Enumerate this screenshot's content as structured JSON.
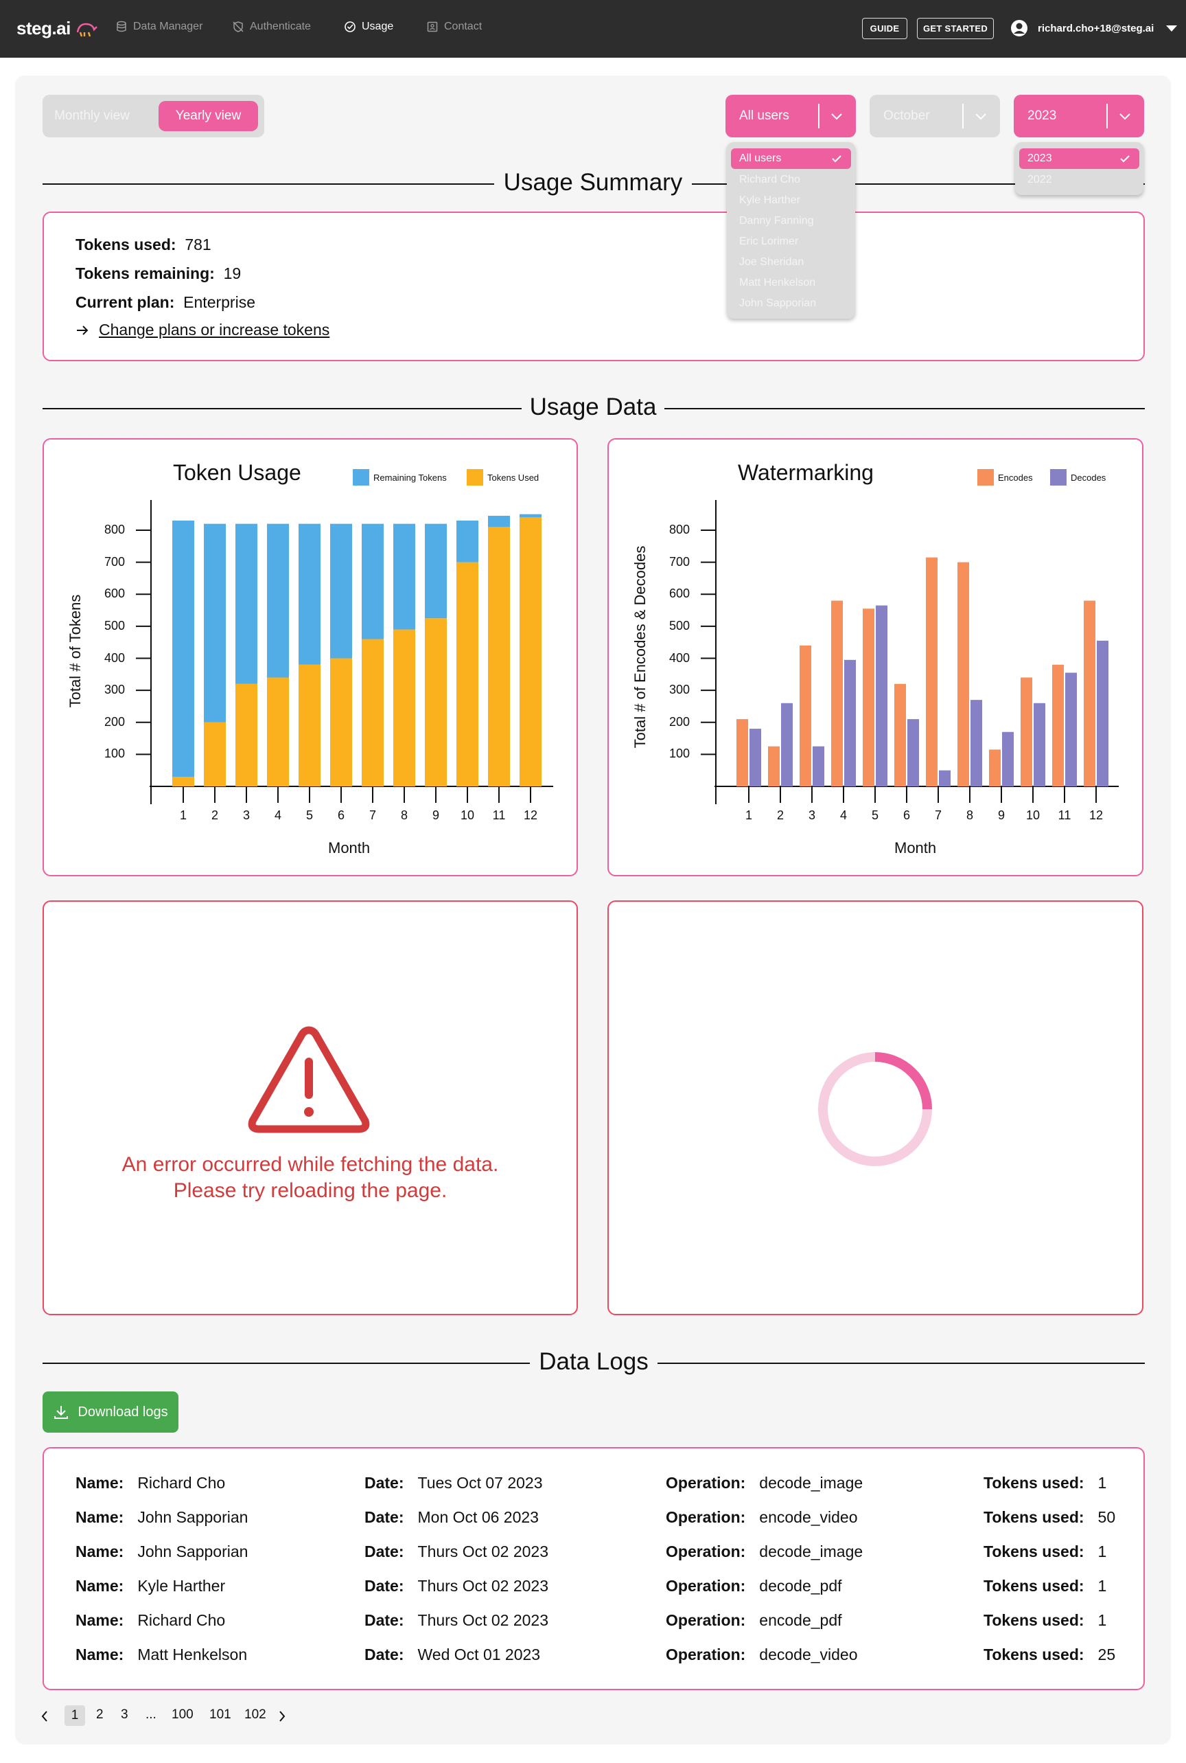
{
  "nav": {
    "logo": "steg.ai",
    "items": [
      {
        "label": "Data Manager",
        "icon": "database-icon"
      },
      {
        "label": "Authenticate",
        "icon": "shield-off-icon"
      },
      {
        "label": "Usage",
        "icon": "check-circle-icon"
      },
      {
        "label": "Contact",
        "icon": "contact-card-icon"
      }
    ],
    "guide_label": "GUIDE",
    "get_started_label": "GET STARTED",
    "user_email": "richard.cho+18@steg.ai"
  },
  "view_toggle": {
    "monthly": "Monthly view",
    "yearly": "Yearly view",
    "selected": "Yearly view"
  },
  "filters": {
    "users": {
      "selected": "All users",
      "options": [
        "All users",
        "Richard Cho",
        "Kyle Harther",
        "Danny Fanning",
        "Eric Lorimer",
        "Joe Sheridan",
        "Matt Henkelson",
        "John Sapporian"
      ]
    },
    "month": {
      "selected": "October"
    },
    "year": {
      "selected": "2023",
      "options": [
        "2023",
        "2022"
      ]
    }
  },
  "colors": {
    "accent": "#ee5fa0",
    "remaining": "#52ace5",
    "used": "#fbb11e",
    "encodes": "#f78f5b",
    "decodes": "#8680c4",
    "error": "#d23b3b",
    "success": "#47a84d"
  },
  "summary": {
    "title": "Usage Summary",
    "tokens_used_label": "Tokens used:",
    "tokens_used": "781",
    "tokens_remaining_label": "Tokens remaining:",
    "tokens_remaining": "19",
    "plan_label": "Current plan:",
    "plan": "Enterprise",
    "change_link": "Change plans or increase tokens"
  },
  "usage_data": {
    "title": "Usage Data"
  },
  "chart_data": [
    {
      "type": "bar",
      "title": "Token Usage",
      "xlabel": "Month",
      "ylabel": "Total # of Tokens",
      "categories": [
        "1",
        "2",
        "3",
        "4",
        "5",
        "6",
        "7",
        "8",
        "9",
        "10",
        "11",
        "12"
      ],
      "series": [
        {
          "name": "Remaining Tokens",
          "values": [
            800,
            620,
            500,
            480,
            440,
            420,
            360,
            330,
            295,
            130,
            35,
            10
          ]
        },
        {
          "name": "Tokens Used",
          "values": [
            30,
            200,
            320,
            340,
            380,
            400,
            460,
            490,
            525,
            700,
            810,
            840
          ]
        }
      ],
      "stacked": true,
      "yticks": [
        100,
        200,
        300,
        400,
        500,
        600,
        700,
        800
      ],
      "ylim": [
        0,
        850
      ],
      "legend": "top-right"
    },
    {
      "type": "bar",
      "title": "Watermarking",
      "xlabel": "Month",
      "ylabel": "Total # of Encodes & Decodes",
      "categories": [
        "1",
        "2",
        "3",
        "4",
        "5",
        "6",
        "7",
        "8",
        "9",
        "10",
        "11",
        "12"
      ],
      "series": [
        {
          "name": "Encodes",
          "values": [
            210,
            125,
            440,
            580,
            555,
            320,
            715,
            700,
            115,
            340,
            380,
            580
          ]
        },
        {
          "name": "Decodes",
          "values": [
            180,
            260,
            125,
            395,
            565,
            210,
            50,
            270,
            170,
            260,
            355,
            455
          ]
        }
      ],
      "yticks": [
        100,
        200,
        300,
        400,
        500,
        600,
        700,
        800
      ],
      "ylim": [
        0,
        850
      ],
      "legend": "top-right"
    }
  ],
  "error_card": {
    "line1": "An error occurred while fetching the data.",
    "line2": "Please try reloading the page."
  },
  "logs": {
    "title": "Data Logs",
    "download_label": "Download logs",
    "keys": {
      "name": "Name:",
      "date": "Date:",
      "operation": "Operation:",
      "tokens": "Tokens used:"
    },
    "rows": [
      {
        "name": "Richard Cho",
        "date": "Tues Oct 07 2023",
        "operation": "decode_image",
        "tokens": "1"
      },
      {
        "name": "John Sapporian",
        "date": "Mon Oct 06 2023",
        "operation": "encode_video",
        "tokens": "50"
      },
      {
        "name": "John Sapporian",
        "date": "Thurs Oct 02 2023",
        "operation": "decode_image",
        "tokens": "1"
      },
      {
        "name": "Kyle Harther",
        "date": "Thurs Oct 02 2023",
        "operation": "decode_pdf",
        "tokens": "1"
      },
      {
        "name": "Richard Cho",
        "date": "Thurs Oct 02 2023",
        "operation": "encode_pdf",
        "tokens": "1"
      },
      {
        "name": "Matt Henkelson",
        "date": "Wed Oct 01 2023",
        "operation": "decode_video",
        "tokens": "25"
      }
    ]
  },
  "pagination": {
    "pages": [
      "1",
      "2",
      "3",
      "...",
      "100",
      "101",
      "102"
    ],
    "current": "1"
  }
}
